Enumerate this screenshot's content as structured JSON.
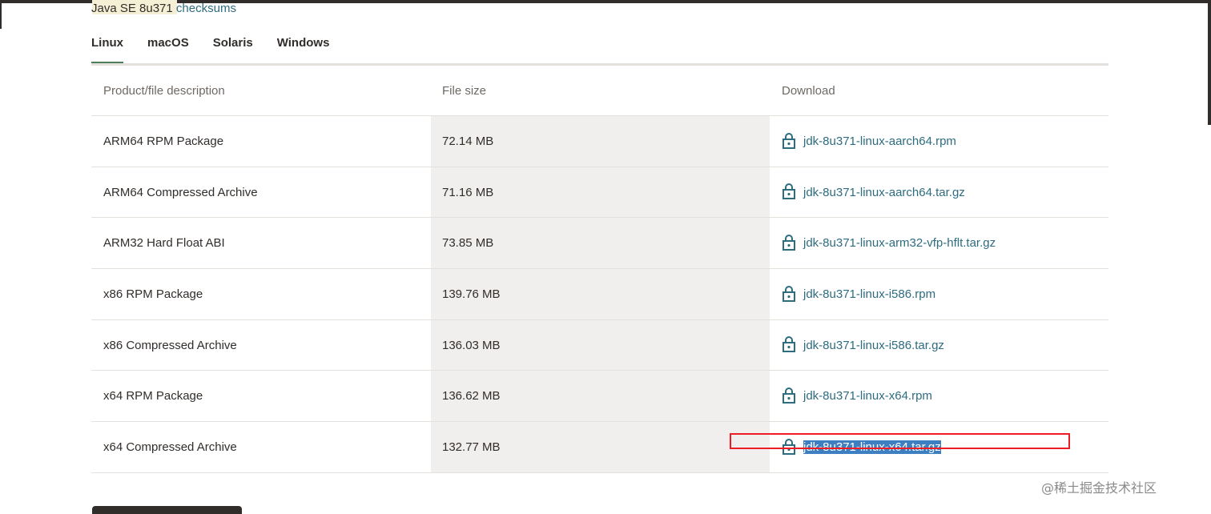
{
  "version_line": {
    "prefix": "Java SE 8u371",
    "checksums_link": "checksums"
  },
  "tabs": [
    {
      "label": "Linux",
      "active": true
    },
    {
      "label": "macOS",
      "active": false
    },
    {
      "label": "Solaris",
      "active": false
    },
    {
      "label": "Windows",
      "active": false
    }
  ],
  "table": {
    "headers": [
      "Product/file description",
      "File size",
      "Download"
    ],
    "rows": [
      {
        "description": "ARM64 RPM Package",
        "size": "72.14 MB",
        "file": "jdk-8u371-linux-aarch64.rpm"
      },
      {
        "description": "ARM64 Compressed Archive",
        "size": "71.16 MB",
        "file": "jdk-8u371-linux-aarch64.tar.gz"
      },
      {
        "description": "ARM32 Hard Float ABI",
        "size": "73.85 MB",
        "file": "jdk-8u371-linux-arm32-vfp-hflt.tar.gz"
      },
      {
        "description": "x86 RPM Package",
        "size": "139.76 MB",
        "file": "jdk-8u371-linux-i586.rpm"
      },
      {
        "description": "x86 Compressed Archive",
        "size": "136.03 MB",
        "file": "jdk-8u371-linux-i586.tar.gz"
      },
      {
        "description": "x64 RPM Package",
        "size": "136.62 MB",
        "file": "jdk-8u371-linux-x64.rpm"
      },
      {
        "description": "x64 Compressed Archive",
        "size": "132.77 MB",
        "file": "jdk-8u371-linux-x64.tar.gz",
        "selected": true
      }
    ]
  },
  "watermark": "@稀土掘金技术社区",
  "icons": {
    "download": "lock-icon"
  },
  "colors": {
    "link": "#2e6c80",
    "active_tab_underline": "#4f7d5a",
    "annotation_box": "#ee1c25",
    "selection": "#3d7fc1"
  }
}
